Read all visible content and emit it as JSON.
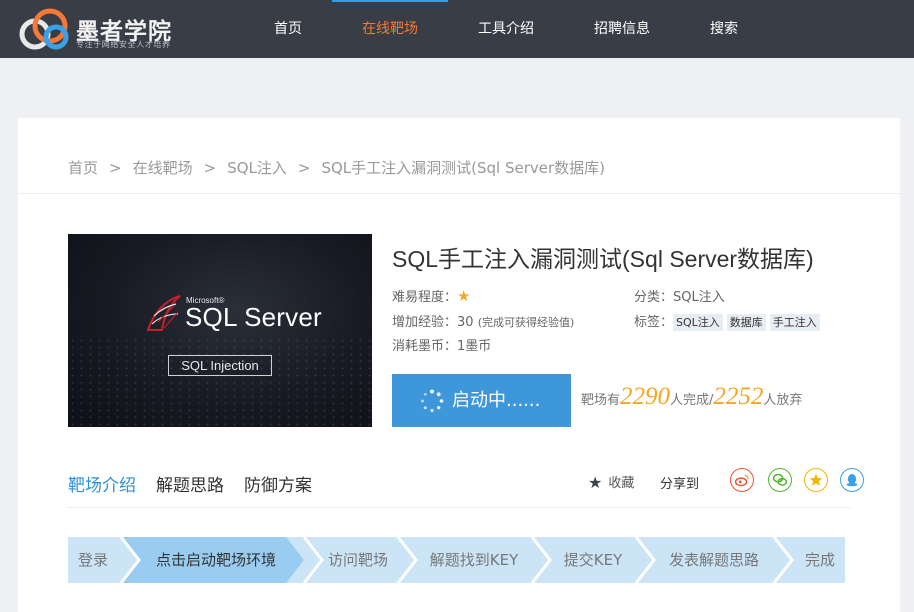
{
  "brand": {
    "name": "墨者学院",
    "slogan": "专注于网络安全人才培养"
  },
  "nav": {
    "items": [
      "首页",
      "在线靶场",
      "工具介绍",
      "招聘信息",
      "搜索"
    ],
    "active_index": 1,
    "active_color": "#f47937"
  },
  "breadcrumb": {
    "items": [
      "首页",
      "在线靶场",
      "SQL注入",
      "SQL手工注入漏洞测试(Sql Server数据库)"
    ],
    "separator": ">"
  },
  "cover": {
    "brand": "Microsoft®",
    "product": "SQL Server",
    "tag": "SQL Injection"
  },
  "challenge": {
    "title": "SQL手工注入漏洞测试(Sql Server数据库)",
    "difficulty_label": "难易程度：",
    "difficulty_stars": 1,
    "exp_label": "增加经验：",
    "exp_value": "30",
    "exp_note": "(完成可获得经验值)",
    "cost_label": "消耗墨币：",
    "cost_value": "1墨币",
    "category_label": "分类：",
    "category_value": "SQL注入",
    "tags_label": "标签：",
    "tags": [
      "SQL注入",
      "数据库",
      "手工注入"
    ]
  },
  "launch": {
    "label": "启动中......",
    "color": "#3e97db"
  },
  "stats": {
    "prefix": "靶场有",
    "completed": "2290",
    "completed_suffix": "人完成/",
    "abandoned": "2252",
    "abandoned_suffix": "人放弃"
  },
  "tabs": {
    "items": [
      "靶场介绍",
      "解题思路",
      "防御方案"
    ],
    "active_index": 0
  },
  "actions": {
    "favorite_label": "收藏",
    "share_label": "分享到",
    "share_icons": [
      "weibo-icon",
      "wechat-icon",
      "favorite-star-icon",
      "qq-icon"
    ]
  },
  "steps": {
    "items": [
      "登录",
      "点击启动靶场环境",
      "访问靶场",
      "解题找到KEY",
      "提交KEY",
      "发表解题思路",
      "完成"
    ],
    "active_index": 1
  }
}
